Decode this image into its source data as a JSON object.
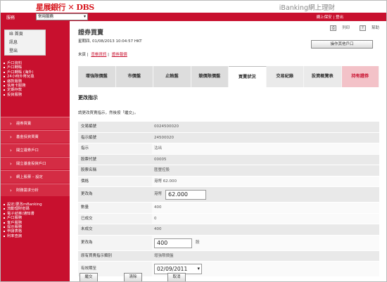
{
  "brand": {
    "logo_text": "星展銀行",
    "logo_suffix": "DBS",
    "title": "iBanking網上理財"
  },
  "topbar": {
    "service_label": "服務",
    "service_select": "常用服務",
    "right_links": "網上保安 | 登出"
  },
  "sidebar": {
    "box_items": [
      "IB 首頁",
      "訊息",
      "登出"
    ],
    "menu_items": [
      "戶口資料",
      "戶口轉賬",
      "戶口轉賬 (海外)",
      "24小時外幣兌換",
      "繳款服務",
      "信用卡服務",
      "定期存款",
      "投資服務"
    ],
    "sub_items": [
      "證券買賣",
      "基金投資買賣",
      "開立證券戶口",
      "開立基金投資戶口",
      "網上股票 – 設定",
      "財務需求分析"
    ],
    "menu_items2": [
      "設定/更改mBanking",
      "流動理財密碼",
      "電子結單/通知書",
      "戶口服務",
      "客戶服務",
      "提示服務",
      "申請表格",
      "利率查詢"
    ]
  },
  "header": {
    "page_title": "證券買賣",
    "print_label": "列印",
    "help_label": "幫助",
    "dateline": "星期四, 01/08/2013 10:04:57 HKT",
    "other_account_button": "操作其他戶口",
    "crumb_home": "末頁",
    "crumb_links": [
      "查帳資訊",
      "證券報價"
    ]
  },
  "tabs": [
    "增強限價盤",
    "市價盤",
    "止蝕盤",
    "競價限價盤",
    "買賣狀況",
    "交易紀錄",
    "投資概覽表",
    "持有證券"
  ],
  "section_title": "更改指示",
  "instruction": "請更改買賣指示，然後按「繼交」。",
  "form": {
    "rows": [
      {
        "label": "交易編號",
        "value": "0024500020"
      },
      {
        "label": "指示編號",
        "value": "24500020"
      },
      {
        "label": "指示",
        "value": "沽出"
      },
      {
        "label": "股票代號",
        "value": "00005"
      },
      {
        "label": "股票名稱",
        "value": "匯豐控股"
      },
      {
        "label": "價格",
        "value": "港幣 62.000"
      }
    ],
    "change_price_label": "更改為",
    "change_price_currency": "港幣",
    "change_price_value": "62.000",
    "qty_label": "數量",
    "qty_value": "400",
    "done_label": "已成交",
    "done_value": "0",
    "undone_label": "未成交",
    "undone_value": "400",
    "change_qty_label": "更改為",
    "change_qty_value": "400",
    "qty_unit": "股",
    "orig_type_label": "原有買賣指示類別",
    "orig_type_value": "增強限價盤",
    "expiry_label": "有效期至",
    "expiry_value": "02/09/2011"
  },
  "buttons": {
    "submit": "繼交",
    "clear": "清除",
    "cancel": "取消"
  }
}
